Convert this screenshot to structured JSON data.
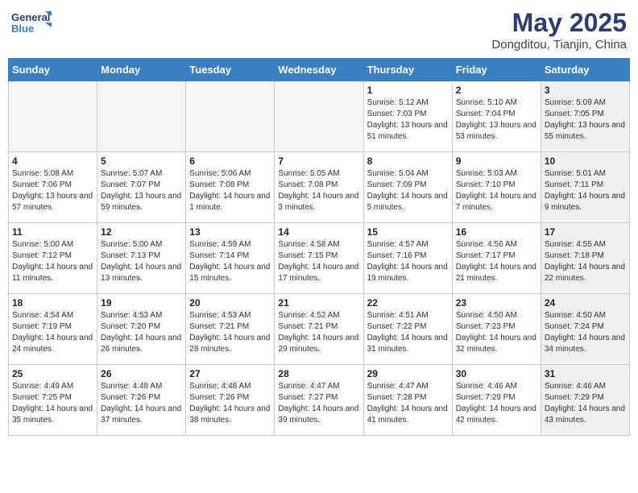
{
  "logo": {
    "line1": "General",
    "line2": "Blue"
  },
  "title": "May 2025",
  "location": "Dongditou, Tianjin, China",
  "weekdays": [
    "Sunday",
    "Monday",
    "Tuesday",
    "Wednesday",
    "Thursday",
    "Friday",
    "Saturday"
  ],
  "weeks": [
    [
      {
        "day": "",
        "sunrise": "",
        "sunset": "",
        "daylight": "",
        "shaded": true
      },
      {
        "day": "",
        "sunrise": "",
        "sunset": "",
        "daylight": "",
        "shaded": true
      },
      {
        "day": "",
        "sunrise": "",
        "sunset": "",
        "daylight": "",
        "shaded": true
      },
      {
        "day": "",
        "sunrise": "",
        "sunset": "",
        "daylight": "",
        "shaded": true
      },
      {
        "day": "1",
        "sunrise": "Sunrise: 5:12 AM",
        "sunset": "Sunset: 7:03 PM",
        "daylight": "Daylight: 13 hours and 51 minutes.",
        "shaded": false
      },
      {
        "day": "2",
        "sunrise": "Sunrise: 5:10 AM",
        "sunset": "Sunset: 7:04 PM",
        "daylight": "Daylight: 13 hours and 53 minutes.",
        "shaded": false
      },
      {
        "day": "3",
        "sunrise": "Sunrise: 5:09 AM",
        "sunset": "Sunset: 7:05 PM",
        "daylight": "Daylight: 13 hours and 55 minutes.",
        "shaded": true
      }
    ],
    [
      {
        "day": "4",
        "sunrise": "Sunrise: 5:08 AM",
        "sunset": "Sunset: 7:06 PM",
        "daylight": "Daylight: 13 hours and 57 minutes.",
        "shaded": false
      },
      {
        "day": "5",
        "sunrise": "Sunrise: 5:07 AM",
        "sunset": "Sunset: 7:07 PM",
        "daylight": "Daylight: 13 hours and 59 minutes.",
        "shaded": false
      },
      {
        "day": "6",
        "sunrise": "Sunrise: 5:06 AM",
        "sunset": "Sunset: 7:08 PM",
        "daylight": "Daylight: 14 hours and 1 minute.",
        "shaded": false
      },
      {
        "day": "7",
        "sunrise": "Sunrise: 5:05 AM",
        "sunset": "Sunset: 7:08 PM",
        "daylight": "Daylight: 14 hours and 3 minutes.",
        "shaded": false
      },
      {
        "day": "8",
        "sunrise": "Sunrise: 5:04 AM",
        "sunset": "Sunset: 7:09 PM",
        "daylight": "Daylight: 14 hours and 5 minutes.",
        "shaded": false
      },
      {
        "day": "9",
        "sunrise": "Sunrise: 5:03 AM",
        "sunset": "Sunset: 7:10 PM",
        "daylight": "Daylight: 14 hours and 7 minutes.",
        "shaded": false
      },
      {
        "day": "10",
        "sunrise": "Sunrise: 5:01 AM",
        "sunset": "Sunset: 7:11 PM",
        "daylight": "Daylight: 14 hours and 9 minutes.",
        "shaded": true
      }
    ],
    [
      {
        "day": "11",
        "sunrise": "Sunrise: 5:00 AM",
        "sunset": "Sunset: 7:12 PM",
        "daylight": "Daylight: 14 hours and 11 minutes.",
        "shaded": false
      },
      {
        "day": "12",
        "sunrise": "Sunrise: 5:00 AM",
        "sunset": "Sunset: 7:13 PM",
        "daylight": "Daylight: 14 hours and 13 minutes.",
        "shaded": false
      },
      {
        "day": "13",
        "sunrise": "Sunrise: 4:59 AM",
        "sunset": "Sunset: 7:14 PM",
        "daylight": "Daylight: 14 hours and 15 minutes.",
        "shaded": false
      },
      {
        "day": "14",
        "sunrise": "Sunrise: 4:58 AM",
        "sunset": "Sunset: 7:15 PM",
        "daylight": "Daylight: 14 hours and 17 minutes.",
        "shaded": false
      },
      {
        "day": "15",
        "sunrise": "Sunrise: 4:57 AM",
        "sunset": "Sunset: 7:16 PM",
        "daylight": "Daylight: 14 hours and 19 minutes.",
        "shaded": false
      },
      {
        "day": "16",
        "sunrise": "Sunrise: 4:56 AM",
        "sunset": "Sunset: 7:17 PM",
        "daylight": "Daylight: 14 hours and 21 minutes.",
        "shaded": false
      },
      {
        "day": "17",
        "sunrise": "Sunrise: 4:55 AM",
        "sunset": "Sunset: 7:18 PM",
        "daylight": "Daylight: 14 hours and 22 minutes.",
        "shaded": true
      }
    ],
    [
      {
        "day": "18",
        "sunrise": "Sunrise: 4:54 AM",
        "sunset": "Sunset: 7:19 PM",
        "daylight": "Daylight: 14 hours and 24 minutes.",
        "shaded": false
      },
      {
        "day": "19",
        "sunrise": "Sunrise: 4:53 AM",
        "sunset": "Sunset: 7:20 PM",
        "daylight": "Daylight: 14 hours and 26 minutes.",
        "shaded": false
      },
      {
        "day": "20",
        "sunrise": "Sunrise: 4:53 AM",
        "sunset": "Sunset: 7:21 PM",
        "daylight": "Daylight: 14 hours and 28 minutes.",
        "shaded": false
      },
      {
        "day": "21",
        "sunrise": "Sunrise: 4:52 AM",
        "sunset": "Sunset: 7:21 PM",
        "daylight": "Daylight: 14 hours and 29 minutes.",
        "shaded": false
      },
      {
        "day": "22",
        "sunrise": "Sunrise: 4:51 AM",
        "sunset": "Sunset: 7:22 PM",
        "daylight": "Daylight: 14 hours and 31 minutes.",
        "shaded": false
      },
      {
        "day": "23",
        "sunrise": "Sunrise: 4:50 AM",
        "sunset": "Sunset: 7:23 PM",
        "daylight": "Daylight: 14 hours and 32 minutes.",
        "shaded": false
      },
      {
        "day": "24",
        "sunrise": "Sunrise: 4:50 AM",
        "sunset": "Sunset: 7:24 PM",
        "daylight": "Daylight: 14 hours and 34 minutes.",
        "shaded": true
      }
    ],
    [
      {
        "day": "25",
        "sunrise": "Sunrise: 4:49 AM",
        "sunset": "Sunset: 7:25 PM",
        "daylight": "Daylight: 14 hours and 35 minutes.",
        "shaded": false
      },
      {
        "day": "26",
        "sunrise": "Sunrise: 4:48 AM",
        "sunset": "Sunset: 7:26 PM",
        "daylight": "Daylight: 14 hours and 37 minutes.",
        "shaded": false
      },
      {
        "day": "27",
        "sunrise": "Sunrise: 4:48 AM",
        "sunset": "Sunset: 7:26 PM",
        "daylight": "Daylight: 14 hours and 38 minutes.",
        "shaded": false
      },
      {
        "day": "28",
        "sunrise": "Sunrise: 4:47 AM",
        "sunset": "Sunset: 7:27 PM",
        "daylight": "Daylight: 14 hours and 39 minutes.",
        "shaded": false
      },
      {
        "day": "29",
        "sunrise": "Sunrise: 4:47 AM",
        "sunset": "Sunset: 7:28 PM",
        "daylight": "Daylight: 14 hours and 41 minutes.",
        "shaded": false
      },
      {
        "day": "30",
        "sunrise": "Sunrise: 4:46 AM",
        "sunset": "Sunset: 7:29 PM",
        "daylight": "Daylight: 14 hours and 42 minutes.",
        "shaded": false
      },
      {
        "day": "31",
        "sunrise": "Sunrise: 4:46 AM",
        "sunset": "Sunset: 7:29 PM",
        "daylight": "Daylight: 14 hours and 43 minutes.",
        "shaded": true
      }
    ]
  ]
}
